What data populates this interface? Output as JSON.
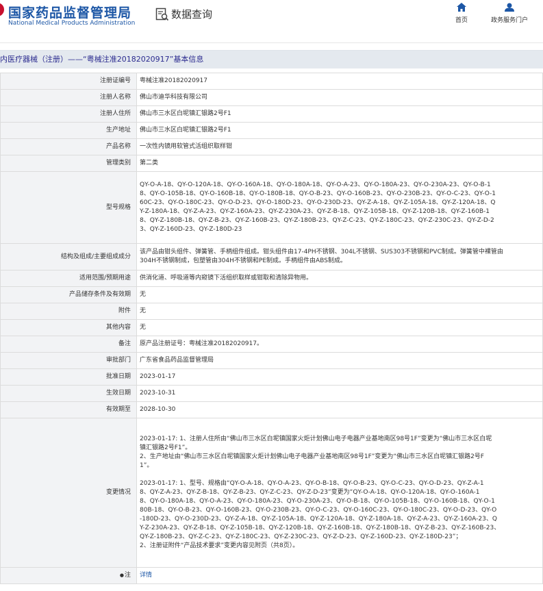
{
  "header": {
    "logo_cn": "国家药品监督管理局",
    "logo_en": "National Medical Products Administration",
    "query_title": "数据查询",
    "nav_home": "首页",
    "nav_gov": "政务服务门户"
  },
  "breadcrumb": "内医疗器械（注册）——“粤械注准20182020917”基本信息",
  "rows": [
    {
      "key": "注册证编号",
      "lines": [
        "粤械注准20182020917"
      ]
    },
    {
      "key": "注册人名称",
      "lines": [
        "佛山市迪华科技有限公司"
      ]
    },
    {
      "key": "注册人住所",
      "lines": [
        "佛山市三水区白坭镇汇银路2号F1"
      ]
    },
    {
      "key": "生产地址",
      "lines": [
        "佛山市三水区白坭镇汇银路2号F1"
      ]
    },
    {
      "key": "产品名称",
      "lines": [
        "一次性内镜用软管式活组织取样钳"
      ]
    },
    {
      "key": "管理类别",
      "lines": [
        "第二类"
      ]
    },
    {
      "key": "型号规格",
      "lines": [
        "QY-O-A-18、QY-O-120A-18、QY-O-160A-18、QY-O-180A-18、QY-O-A-23、QY-O-180A-23、QY-O-230A-23、QY-O-B-1",
        "8、QY-O-105B-18、QY-O-160B-18、QY-O-180B-18、QY-O-B-23、QY-O-160B-23、QY-O-230B-23、QY-O-C-23、QY-O-1",
        "60C-23、QY-O-180C-23、QY-O-D-23、QY-O-180D-23、QY-O-230D-23、QY-Z-A-18、QY-Z-105A-18、QY-Z-120A-18、Q",
        "Y-Z-180A-18、QY-Z-A-23、QY-Z-160A-23、QY-Z-230A-23、QY-Z-B-18、QY-Z-105B-18、QY-Z-120B-18、QY-Z-160B-1",
        "8、QY-Z-180B-18、QY-Z-B-23、QY-Z-160B-23、QY-Z-180B-23、QY-Z-C-23、QY-Z-180C-23、QY-Z-230C-23、QY-Z-D-2",
        "3、QY-Z-160D-23、QY-Z-180D-23"
      ]
    },
    {
      "key": "结构及组成/主要组成成分",
      "lines": [
        "该产品由钳头组件、弹簧管、手柄组件组成。钳头组件由17-4PH不锈钢、304L不锈钢、SUS303不锈钢和PVC制成。弹簧管中裸管由",
        "304H不锈钢制成，包塑管由304H不锈钢和PE制成。手柄组件由ABS制成。"
      ]
    },
    {
      "key": "适用范围/预期用途",
      "lines": [
        "供消化道、呼吸道等内窥镜下活组织取样或钳取和清除异物用。"
      ]
    },
    {
      "key": "产品储存条件及有效期",
      "lines": [
        "无"
      ]
    },
    {
      "key": "附件",
      "lines": [
        "无"
      ]
    },
    {
      "key": "其他内容",
      "lines": [
        "无"
      ]
    },
    {
      "key": "备注",
      "lines": [
        "原产品注册证号：粤械注准20182020917。"
      ]
    },
    {
      "key": "审批部门",
      "lines": [
        "广东省食品药品监督管理局"
      ]
    },
    {
      "key": "批准日期",
      "lines": [
        "2023-01-17"
      ]
    },
    {
      "key": "生效日期",
      "lines": [
        "2023-10-31"
      ]
    },
    {
      "key": "有效期至",
      "lines": [
        "2028-10-30"
      ]
    },
    {
      "key": "变更情况",
      "lines": [
        "2023-01-17: 1、注册人住所由“佛山市三水区白坭镇国家火炬计划佛山电子电器产业基地南区98号1F”变更为“佛山市三水区白坭",
        "镇汇银路2号F1”。",
        "2、生产地址由“佛山市三水区白坭镇国家火炬计划佛山电子电器产业基地南区98号1F”变更为“佛山市三水区白坭镇汇银路2号F",
        "1”。",
        "",
        "2023-01-17: 1、型号、规格由“QY-O-A-18、QY-O-A-23、QY-O-B-18、QY-O-B-23、QY-O-C-23、QY-O-D-23、QY-Z-A-1",
        "8、QY-Z-A-23、QY-Z-B-18、QY-Z-B-23、QY-Z-C-23、QY-Z-D-23”变更为“QY-O-A-18、QY-O-120A-18、QY-O-160A-1",
        "8、QY-O-180A-18、QY-O-A-23、QY-O-180A-23、QY-O-230A-23、QY-O-B-18、QY-O-105B-18、QY-O-160B-18、QY-O-1",
        "80B-18、QY-O-B-23、QY-O-160B-23、QY-O-230B-23、QY-O-C-23、QY-O-160C-23、QY-O-180C-23、QY-O-D-23、QY-O",
        "-180D-23、QY-O-230D-23、QY-Z-A-18、QY-Z-105A-18、QY-Z-120A-18、QY-Z-180A-18、QY-Z-A-23、QY-Z-160A-23、Q",
        "Y-Z-230A-23、QY-Z-B-18、QY-Z-105B-18、QY-Z-120B-18、QY-Z-160B-18、QY-Z-180B-18、QY-Z-B-23、QY-Z-160B-23、",
        "QY-Z-180B-23、QY-Z-C-23、QY-Z-180C-23、QY-Z-230C-23、QY-Z-D-23、QY-Z-160D-23、QY-Z-180D-23”；",
        "2、注册证附件“产品技术要求”变更内容见附页（共8页）。"
      ]
    },
    {
      "key": "注",
      "key_icon": "bullet-icon",
      "lines": [
        "详情"
      ],
      "link": true
    }
  ],
  "colors": {
    "brand_blue": "#1d57a6",
    "breadcrumb_bg": "#e4e9ef",
    "label_bg": "#f2f3f5"
  }
}
